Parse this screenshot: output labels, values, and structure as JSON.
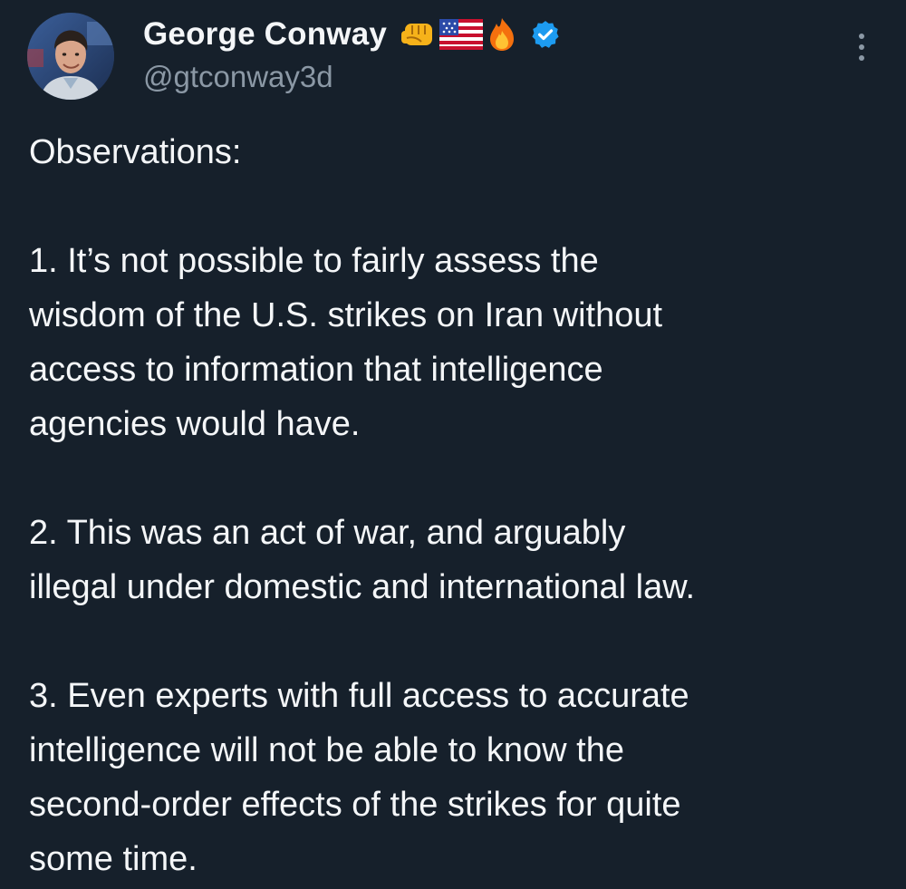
{
  "author": {
    "display_name": "George Conway",
    "handle": "@gtconway3d",
    "emojis": [
      "fist-emoji",
      "us-flag-emoji",
      "fire-emoji"
    ],
    "verified_icon": "verified-badge-icon",
    "avatar_icon": "profile-photo"
  },
  "menu": {
    "more_icon": "more-options-icon"
  },
  "tweet": {
    "intro": "Observations:",
    "point_1": "1.  It’s not possible to fairly assess the\nwisdom of the U.S. strikes on Iran without\naccess to information that intelligence\nagencies would have.",
    "point_2": "2.  This was an act of war, and arguably\nillegal under domestic and international law.",
    "point_3": "3.   Even experts with full access to accurate\nintelligence will not be able to know the\nsecond-order effects of the strikes for quite\nsome time."
  },
  "colors": {
    "background": "#16202b",
    "text": "#f4f6f8",
    "secondary_text": "#8b98a5",
    "verified_blue": "#1d9bf0"
  }
}
